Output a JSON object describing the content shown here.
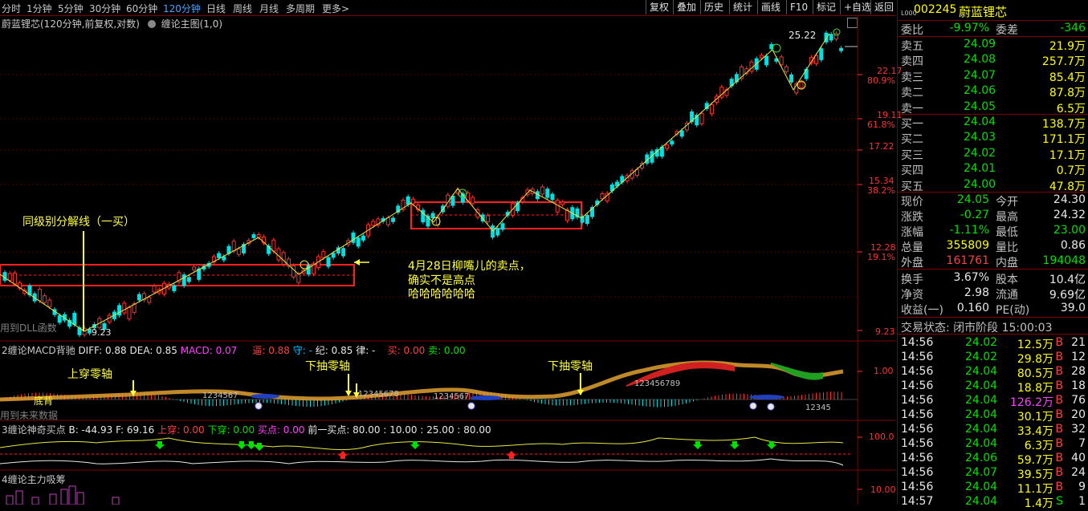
{
  "toolbar": {
    "timeframes": [
      "分时",
      "1分钟",
      "5分钟",
      "30分钟",
      "60分钟",
      "120分钟",
      "日线",
      "周线",
      "月线",
      "多周期",
      "更多"
    ],
    "active_timeframe": "120分钟",
    "right_buttons": [
      "复权",
      "叠加",
      "历史",
      "统计",
      "画线",
      "F10",
      "标记",
      "+自选",
      "返回"
    ]
  },
  "chart_header": {
    "title": "蔚蓝锂芯(120分钟,前复权,对数)",
    "indicator": "缠论主图(1,0)"
  },
  "price_axis": [
    {
      "price": "22.17",
      "pct": "80.9%"
    },
    {
      "price": "19.11",
      "pct": "61.8%"
    },
    {
      "price": "17.22",
      "pct": ""
    },
    {
      "price": "15.34",
      "pct": "38.2%"
    },
    {
      "price": "12.28",
      "pct": "19.1%"
    },
    {
      "price": "9.23",
      "pct": ""
    }
  ],
  "chart_marks": {
    "high": "25.22",
    "low": "9.23",
    "dll_note": "用到DLL函数"
  },
  "annotations": {
    "first_buy": "同级别分解线（一买）",
    "sell_point_l1": "4月28日柳嘴儿的卖点，",
    "sell_point_l2": "确实不是高点",
    "sell_point_l3": "哈哈哈哈哈哈"
  },
  "macd_panel": {
    "title": "2缠论MACD背驰",
    "diff": "DIFF: 0.88",
    "dea": "DEA: 0.85",
    "macd": "MACD: 0.07",
    "extra1": "逼: 0.88",
    "extra2": "守: -",
    "extra3": "纪: 0.85",
    "extra4": "律: -",
    "buy": "买: 0.00",
    "sell": "卖: 0.00",
    "axis": "1.00",
    "note1": "上穿零轴",
    "note2": "下抽零轴",
    "note3": "下抽零轴",
    "future_note": "用到未来数据",
    "bei_label": "底背",
    "seq1": "1234567",
    "seq2": "12345678",
    "seq3": "1234567",
    "seq4": "123456789",
    "seq5": "12345"
  },
  "magic_panel": {
    "title": "3缠论神奇买点",
    "b": "B: -44.93",
    "f": "F: 69.16",
    "up": "上穿: 0.00",
    "down": "下穿: 0.00",
    "buy": "买点: 0.00",
    "prev": "前一买点: 80.00 : 10.00 : 25.00 : 80.00",
    "axis": "100.0"
  },
  "chip_panel": {
    "title": "4缠论主力吸筹",
    "axis": "10.00"
  },
  "quote": {
    "code": "002245",
    "name": "蔚蓝锂芯",
    "badge": "L000",
    "weibi_lbl": "委比",
    "weibi": "-9.97%",
    "weicha_lbl": "委差",
    "weicha": "-346",
    "asks": [
      {
        "label": "卖五",
        "price": "24.09",
        "vol": "21.9万"
      },
      {
        "label": "卖四",
        "price": "24.08",
        "vol": "257.7万"
      },
      {
        "label": "卖三",
        "price": "24.07",
        "vol": "85.4万"
      },
      {
        "label": "卖二",
        "price": "24.06",
        "vol": "87.8万"
      },
      {
        "label": "卖一",
        "price": "24.05",
        "vol": "6.5万"
      }
    ],
    "bids": [
      {
        "label": "买一",
        "price": "24.04",
        "vol": "138.7万"
      },
      {
        "label": "买二",
        "price": "24.03",
        "vol": "171.1万"
      },
      {
        "label": "买三",
        "price": "24.02",
        "vol": "17.1万"
      },
      {
        "label": "买四",
        "price": "24.01",
        "vol": "0.7万"
      },
      {
        "label": "买五",
        "price": "24.00",
        "vol": "47.8万"
      }
    ],
    "stats": [
      {
        "l1": "现价",
        "v1": "24.05",
        "l2": "今开",
        "v2": "24.30"
      },
      {
        "l1": "涨跌",
        "v1": "-0.27",
        "l2": "最高",
        "v2": "24.32"
      },
      {
        "l1": "涨幅",
        "v1": "-1.11%",
        "l2": "最低",
        "v2": "23.00"
      },
      {
        "l1": "总量",
        "v1": "355809",
        "l2": "量比",
        "v2": "0.86"
      },
      {
        "l1": "外盘",
        "v1": "161761",
        "l2": "内盘",
        "v2": "194048"
      }
    ],
    "stats2": [
      {
        "l1": "换手",
        "v1": "3.67%",
        "l2": "股本",
        "v2": "10.4亿"
      },
      {
        "l1": "净资",
        "v1": "2.98",
        "l2": "流通",
        "v2": "9.69亿"
      },
      {
        "l1": "收益(一)",
        "v1": "0.160",
        "l2": "PE(动)",
        "v2": "39.0"
      }
    ],
    "trade_status": "交易状态: 闭市阶段 15:00:03",
    "ticks": [
      {
        "t": "14:56",
        "p": "24.02",
        "v": "12.5万",
        "s": "B",
        "n": "21"
      },
      {
        "t": "14:56",
        "p": "24.02",
        "v": "29.8万",
        "s": "B",
        "n": "12"
      },
      {
        "t": "14:56",
        "p": "24.04",
        "v": "80.5万",
        "s": "B",
        "n": "28"
      },
      {
        "t": "14:56",
        "p": "24.04",
        "v": "18.8万",
        "s": "B",
        "n": "18"
      },
      {
        "t": "14:56",
        "p": "24.04",
        "v": "126.2万",
        "s": "B",
        "n": "76"
      },
      {
        "t": "14:56",
        "p": "24.04",
        "v": "30.1万",
        "s": "B",
        "n": "20"
      },
      {
        "t": "14:56",
        "p": "24.04",
        "v": "33.4万",
        "s": "B",
        "n": "32"
      },
      {
        "t": "14:56",
        "p": "24.04",
        "v": "6.3万",
        "s": "B",
        "n": "7"
      },
      {
        "t": "14:56",
        "p": "24.06",
        "v": "59.7万",
        "s": "B",
        "n": "40"
      },
      {
        "t": "14:56",
        "p": "24.07",
        "v": "39.5万",
        "s": "B",
        "n": "24"
      },
      {
        "t": "14:56",
        "p": "24.04",
        "v": "11.1万",
        "s": "B",
        "n": "9"
      },
      {
        "t": "14:57",
        "p": "24.04",
        "v": "1.4万",
        "s": "S",
        "n": "1"
      }
    ]
  },
  "colors": {
    "up": "#ff3030",
    "down": "#00e0e0",
    "frame": "#800000",
    "zs_box": "#ff2020",
    "zigzag": "#e8e840",
    "annotation": "#ffff40"
  }
}
